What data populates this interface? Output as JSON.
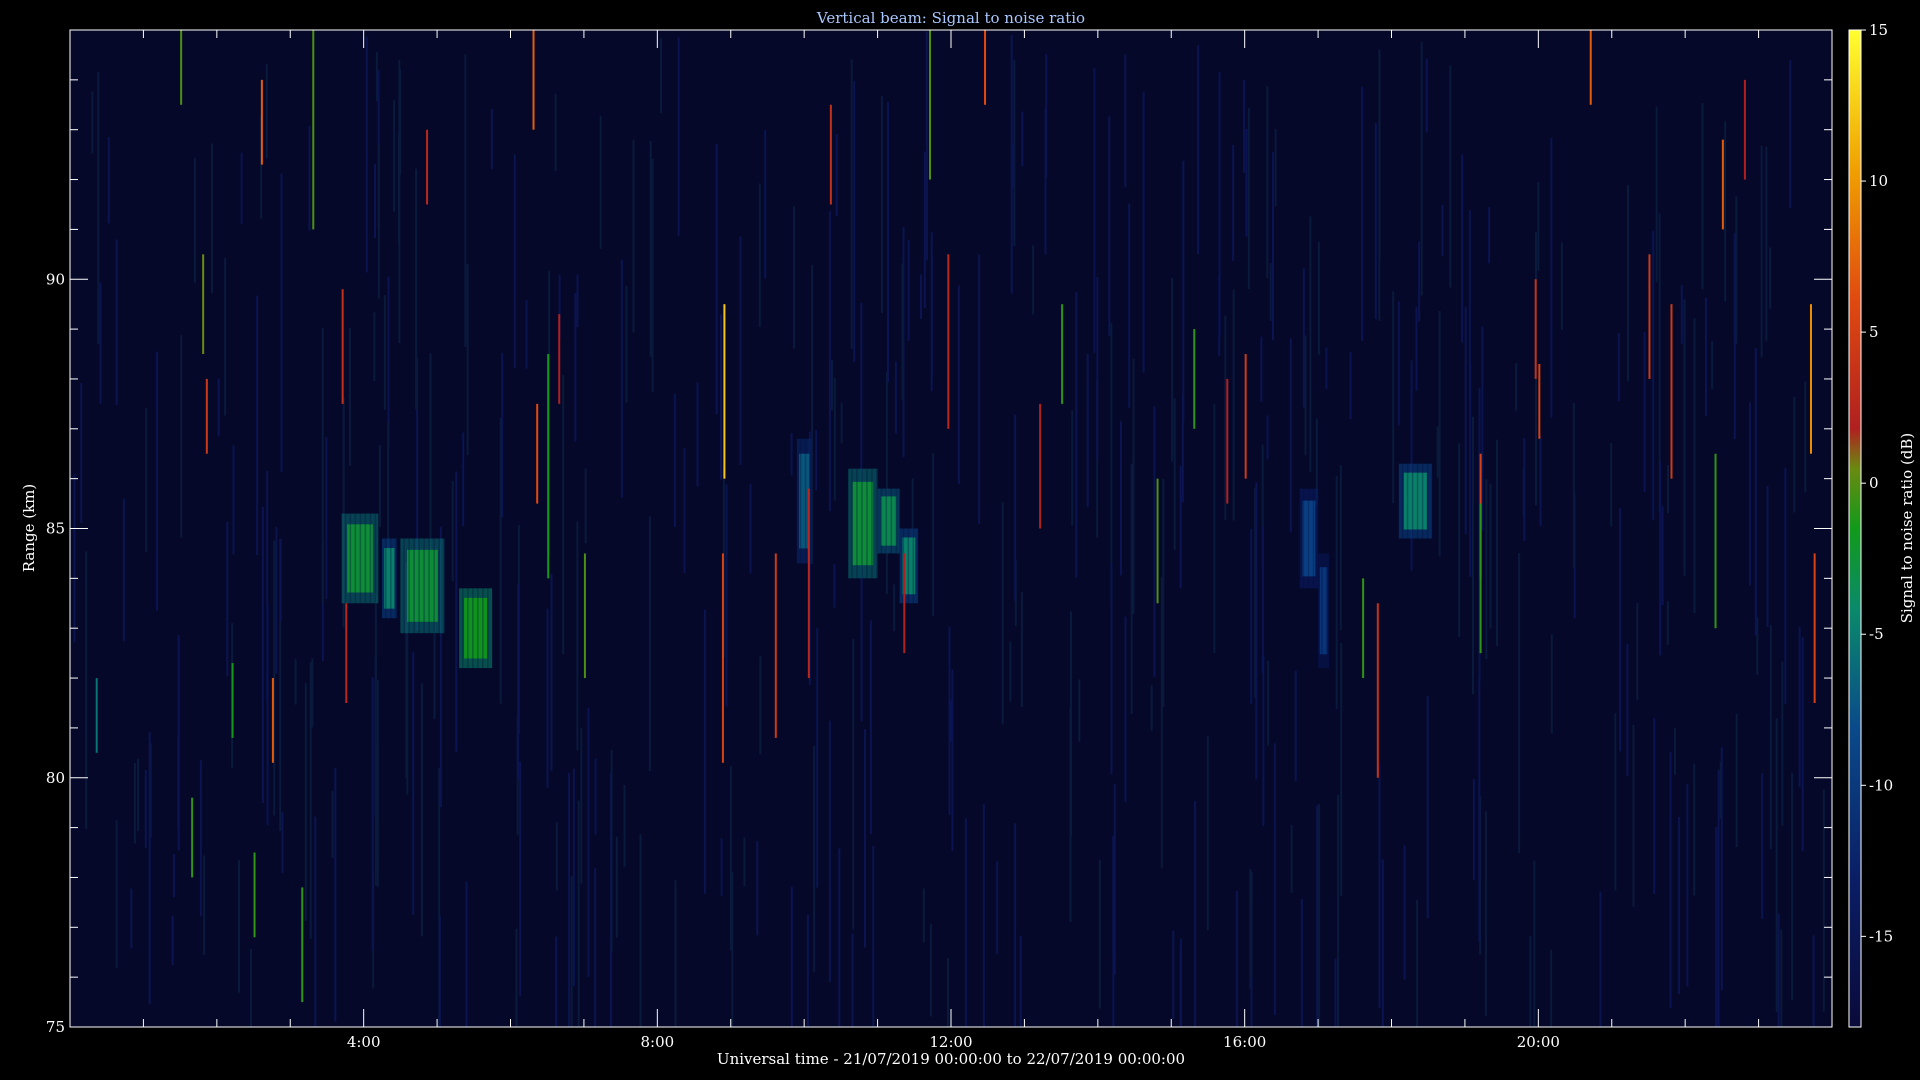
{
  "chart_data": {
    "type": "heatmap",
    "title": "Vertical beam: Signal to noise ratio",
    "xlabel": "Universal time - 21/07/2019 00:00:00 to 22/07/2019 00:00:00",
    "ylabel": "Range (km)",
    "colorbar_label": "Signal to noise ratio (dB)",
    "x_range_hours": [
      0,
      24
    ],
    "y_range_km": [
      75,
      95
    ],
    "colorbar_range_db": [
      -18,
      15
    ],
    "x_ticks": [
      {
        "hour": 4,
        "label": "4:00"
      },
      {
        "hour": 8,
        "label": "8:00"
      },
      {
        "hour": 12,
        "label": "12:00"
      },
      {
        "hour": 16,
        "label": "16:00"
      },
      {
        "hour": 20,
        "label": "20:00"
      }
    ],
    "y_ticks": [
      {
        "km": 75,
        "label": "75"
      },
      {
        "km": 80,
        "label": "80"
      },
      {
        "km": 85,
        "label": "85"
      },
      {
        "km": 90,
        "label": "90"
      }
    ],
    "colorbar_ticks": [
      {
        "db": 15,
        "label": "15"
      },
      {
        "db": 10,
        "label": "10"
      },
      {
        "db": 5,
        "label": "5"
      },
      {
        "db": 0,
        "label": "0"
      },
      {
        "db": -5,
        "label": "-5"
      },
      {
        "db": -10,
        "label": "-10"
      },
      {
        "db": -15,
        "label": "-15"
      }
    ],
    "echo_regions": [
      {
        "t0": 3.7,
        "t1": 4.2,
        "r0": 83.5,
        "r1": 85.3,
        "db": -7
      },
      {
        "t0": 4.25,
        "t1": 4.45,
        "r0": 83.2,
        "r1": 84.8,
        "db": -9
      },
      {
        "t0": 4.5,
        "t1": 5.1,
        "r0": 82.9,
        "r1": 84.8,
        "db": -7
      },
      {
        "t0": 5.3,
        "t1": 5.75,
        "r0": 82.2,
        "r1": 83.8,
        "db": -6
      },
      {
        "t0": 9.9,
        "t1": 10.1,
        "r0": 84.3,
        "r1": 86.8,
        "db": -11
      },
      {
        "t0": 10.6,
        "t1": 11.0,
        "r0": 84.0,
        "r1": 86.2,
        "db": -7
      },
      {
        "t0": 11.0,
        "t1": 11.3,
        "r0": 84.5,
        "r1": 85.8,
        "db": -8
      },
      {
        "t0": 11.3,
        "t1": 11.55,
        "r0": 83.5,
        "r1": 85.0,
        "db": -9
      },
      {
        "t0": 16.75,
        "t1": 17.0,
        "r0": 83.8,
        "r1": 85.8,
        "db": -12
      },
      {
        "t0": 17.0,
        "t1": 17.15,
        "r0": 82.2,
        "r1": 84.5,
        "db": -13
      },
      {
        "t0": 18.1,
        "t1": 18.55,
        "r0": 84.8,
        "r1": 86.3,
        "db": -9
      }
    ],
    "streaks": [
      {
        "t": 1.5,
        "r0": 93.5,
        "r1": 95,
        "db": -4
      },
      {
        "t": 1.8,
        "r0": 88.5,
        "r1": 90.5,
        "db": -3
      },
      {
        "t": 1.85,
        "r0": 86.5,
        "r1": 88.0,
        "db": 3
      },
      {
        "t": 2.6,
        "r0": 92.3,
        "r1": 94.0,
        "db": 6
      },
      {
        "t": 3.3,
        "r0": 91.0,
        "r1": 95.0,
        "db": -4
      },
      {
        "t": 3.7,
        "r0": 87.5,
        "r1": 89.8,
        "db": 2
      },
      {
        "t": 3.75,
        "r0": 81.5,
        "r1": 83.5,
        "db": 1
      },
      {
        "t": 4.85,
        "r0": 91.5,
        "r1": 93.0,
        "db": 1
      },
      {
        "t": 2.75,
        "r0": 80.3,
        "r1": 82.0,
        "db": 6
      },
      {
        "t": 2.5,
        "r0": 76.8,
        "r1": 78.5,
        "db": -5
      },
      {
        "t": 3.15,
        "r0": 75.5,
        "r1": 77.8,
        "db": -5
      },
      {
        "t": 1.65,
        "r0": 78.0,
        "r1": 79.6,
        "db": -5
      },
      {
        "t": 6.35,
        "r0": 85.5,
        "r1": 87.5,
        "db": 5
      },
      {
        "t": 6.5,
        "r0": 84.0,
        "r1": 88.5,
        "db": -6
      },
      {
        "t": 6.65,
        "r0": 87.5,
        "r1": 89.3,
        "db": 0
      },
      {
        "t": 6.3,
        "r0": 93.0,
        "r1": 95.0,
        "db": 6
      },
      {
        "t": 8.9,
        "r0": 86.0,
        "r1": 89.5,
        "db": 12
      },
      {
        "t": 8.88,
        "r0": 80.3,
        "r1": 84.5,
        "db": 4
      },
      {
        "t": 10.05,
        "r0": 82.0,
        "r1": 85.8,
        "db": 1
      },
      {
        "t": 9.6,
        "r0": 80.8,
        "r1": 84.5,
        "db": 3
      },
      {
        "t": 10.35,
        "r0": 91.5,
        "r1": 93.5,
        "db": 2
      },
      {
        "t": 11.7,
        "r0": 92.0,
        "r1": 95.0,
        "db": -4
      },
      {
        "t": 12.45,
        "r0": 93.5,
        "r1": 95.0,
        "db": 5
      },
      {
        "t": 11.95,
        "r0": 87.0,
        "r1": 90.5,
        "db": 1
      },
      {
        "t": 11.35,
        "r0": 82.5,
        "r1": 84.5,
        "db": 0
      },
      {
        "t": 13.2,
        "r0": 85.0,
        "r1": 87.5,
        "db": 0
      },
      {
        "t": 13.5,
        "r0": 87.5,
        "r1": 89.5,
        "db": -5
      },
      {
        "t": 15.3,
        "r0": 87.0,
        "r1": 89.0,
        "db": -5
      },
      {
        "t": 16.0,
        "r0": 86.0,
        "r1": 88.5,
        "db": 3
      },
      {
        "t": 15.75,
        "r0": 85.5,
        "r1": 88.0,
        "db": 0
      },
      {
        "t": 17.8,
        "r0": 80.0,
        "r1": 83.5,
        "db": 2
      },
      {
        "t": 17.6,
        "r0": 82.0,
        "r1": 84.0,
        "db": -5
      },
      {
        "t": 19.2,
        "r0": 84.0,
        "r1": 86.5,
        "db": 4
      },
      {
        "t": 19.95,
        "r0": 88.0,
        "r1": 90.0,
        "db": 2
      },
      {
        "t": 20.0,
        "r0": 86.8,
        "r1": 88.3,
        "db": 4
      },
      {
        "t": 20.7,
        "r0": 93.5,
        "r1": 95.0,
        "db": 6
      },
      {
        "t": 21.8,
        "r0": 86.0,
        "r1": 89.5,
        "db": 3
      },
      {
        "t": 22.5,
        "r0": 91.0,
        "r1": 92.8,
        "db": 6
      },
      {
        "t": 22.8,
        "r0": 92.0,
        "r1": 94.0,
        "db": 0
      },
      {
        "t": 23.7,
        "r0": 86.5,
        "r1": 89.5,
        "db": 9
      },
      {
        "t": 23.75,
        "r0": 81.5,
        "r1": 84.5,
        "db": 4
      },
      {
        "t": 21.5,
        "r0": 88.0,
        "r1": 90.5,
        "db": 3
      },
      {
        "t": 22.4,
        "r0": 83.0,
        "r1": 86.5,
        "db": -5
      },
      {
        "t": 19.2,
        "r0": 82.5,
        "r1": 85.5,
        "db": -5
      },
      {
        "t": 14.8,
        "r0": 83.5,
        "r1": 86.0,
        "db": -4
      },
      {
        "t": 7.0,
        "r0": 82.0,
        "r1": 84.5,
        "db": -4
      },
      {
        "t": 2.2,
        "r0": 80.8,
        "r1": 82.3,
        "db": -6
      },
      {
        "t": 0.35,
        "r0": 80.5,
        "r1": 82.0,
        "db": -10
      }
    ]
  }
}
